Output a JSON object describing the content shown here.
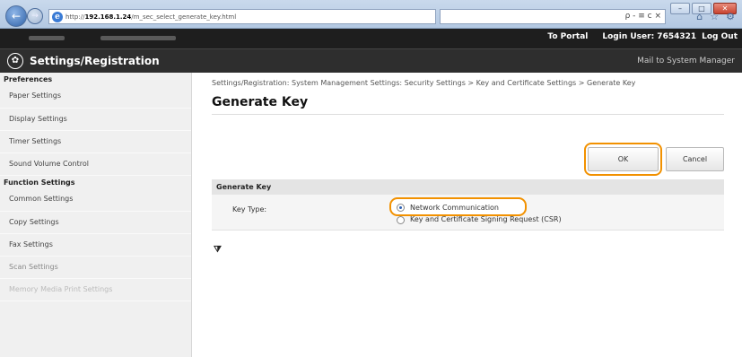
{
  "browser": {
    "url_prefix": "http://",
    "url_host": "192.168.1.24",
    "url_path": "/m_sec_select_generate_key.html",
    "addr_tools": "ρ - ≡ c ×",
    "window_controls": [
      "–",
      "□",
      "✕"
    ],
    "toolbar_icons": [
      "⌂",
      "☆",
      "⚙"
    ]
  },
  "device_bar": {
    "to_portal": "To Portal",
    "login_user": "Login User:  7654321",
    "logout": "Log Out"
  },
  "header": {
    "title": "Settings/Registration",
    "mail_link": "Mail to System Manager"
  },
  "sidebar": {
    "preferences_heading": "Preferences",
    "preferences": [
      "Paper Settings",
      "Display Settings",
      "Timer Settings",
      "Sound Volume Control"
    ],
    "function_heading": "Function Settings",
    "function": [
      "Common Settings",
      "Copy Settings",
      "Fax Settings",
      "Scan Settings",
      "Memory Media Print Settings"
    ]
  },
  "main": {
    "breadcrumb": "Settings/Registration: System Management Settings: Security Settings > Key and Certificate Settings > Generate Key",
    "page_title": "Generate Key",
    "ok_label": "OK",
    "cancel_label": "Cancel",
    "panel_title": "Generate Key",
    "field_label": "Key Type:",
    "options": [
      "Network Communication",
      "Key and Certificate Signing Request (CSR)"
    ],
    "selected_option": "Network Communication",
    "top_link": "⧩"
  },
  "colors": {
    "highlight": "#f29100",
    "header_bg": "#2e2e2e",
    "device_bar_bg": "#1e1e1e"
  }
}
